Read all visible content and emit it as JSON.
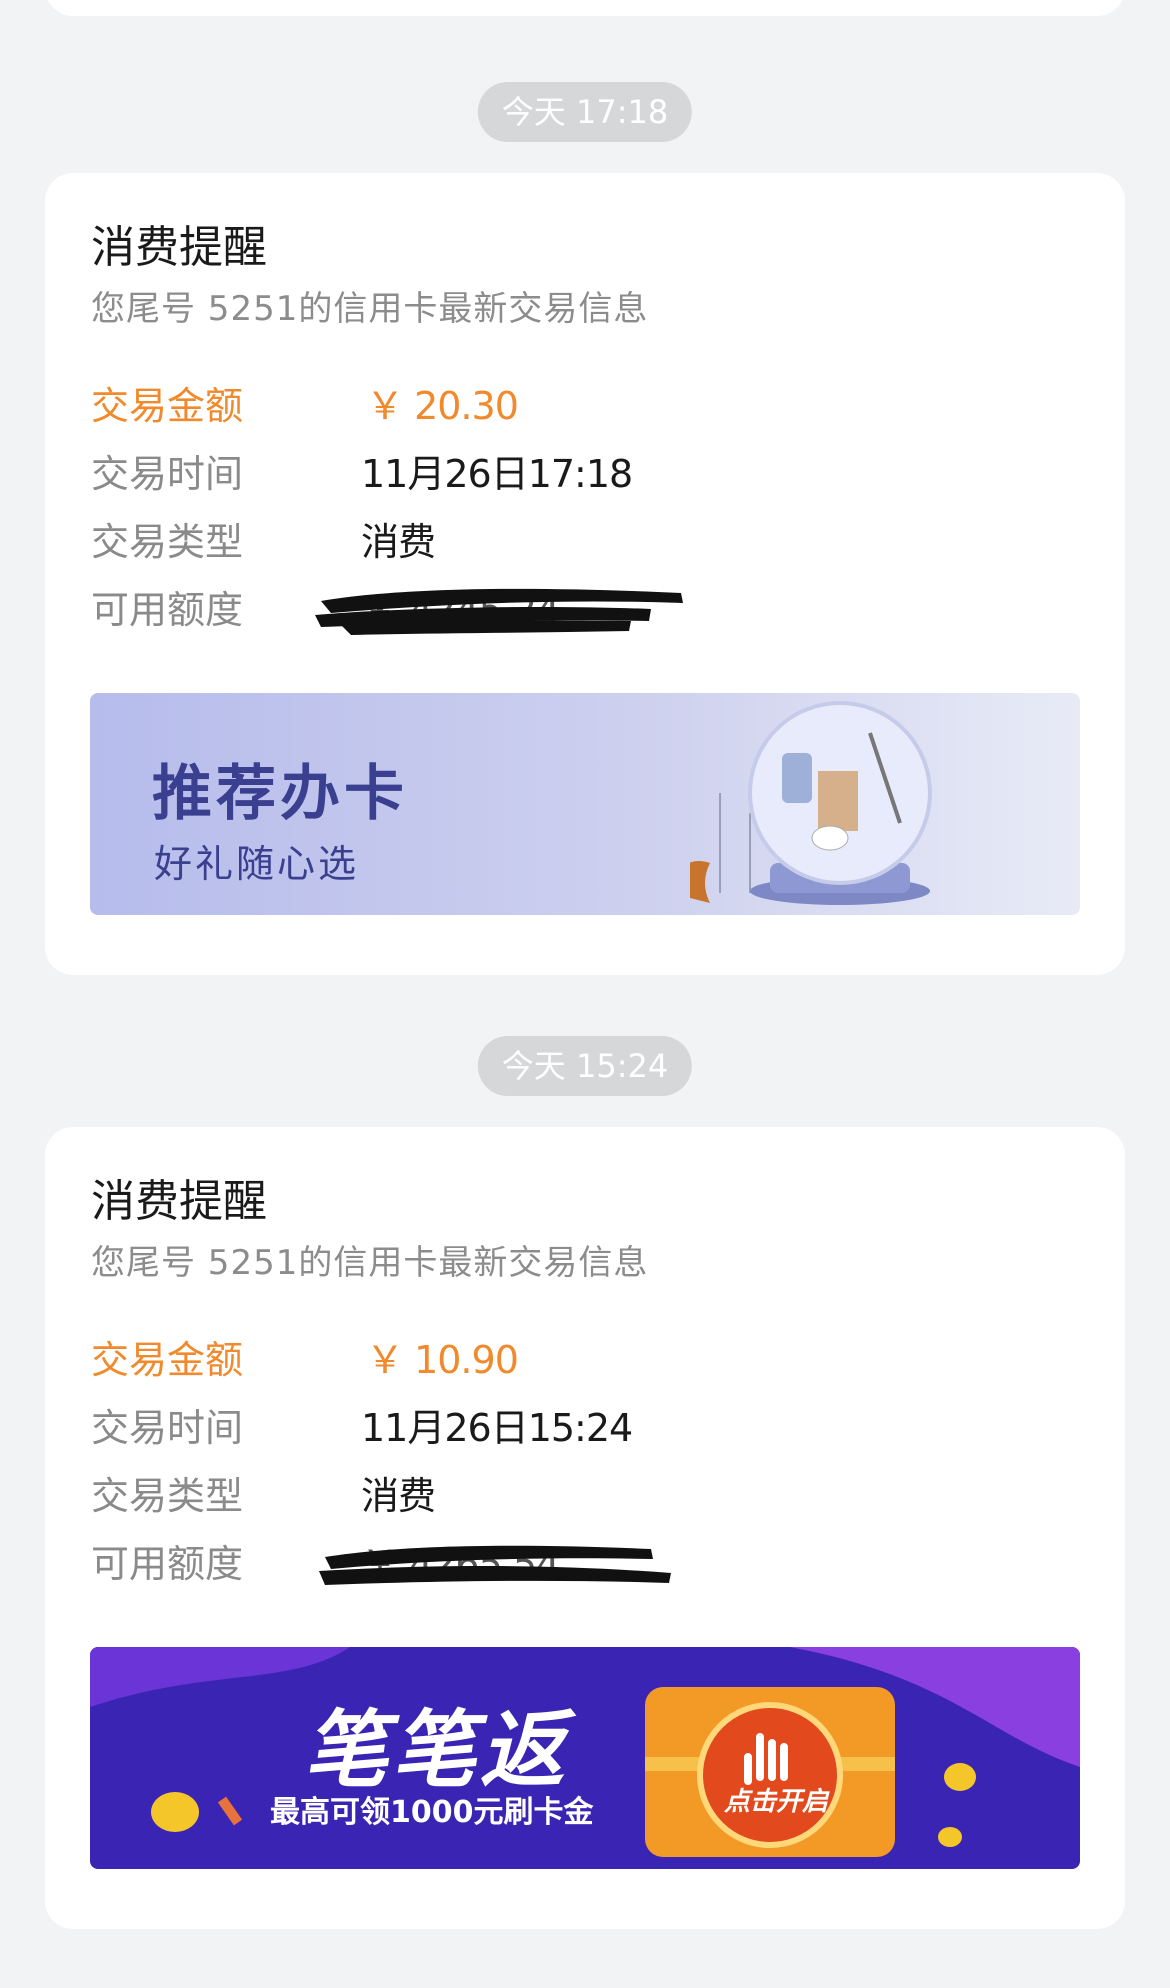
{
  "messages": [
    {
      "time": "今天 17:18",
      "title": "消费提醒",
      "subtitle": "您尾号 5251的信用卡最新交易信息",
      "rows": [
        {
          "label": "交易金额",
          "value": "￥ 20.30"
        },
        {
          "label": "交易时间",
          "value": "11月26日17:18"
        },
        {
          "label": "交易类型",
          "value": "消费"
        },
        {
          "label": "可用额度",
          "value": "￥ 4245.24"
        }
      ],
      "banner": {
        "title": "推荐办卡",
        "subtitle": "好礼随心选"
      }
    },
    {
      "time": "今天 15:24",
      "title": "消费提醒",
      "subtitle": "您尾号 5251的信用卡最新交易信息",
      "rows": [
        {
          "label": "交易金额",
          "value": "￥ 10.90"
        },
        {
          "label": "交易时间",
          "value": "11月26日15:24"
        },
        {
          "label": "交易类型",
          "value": "消费"
        },
        {
          "label": "可用额度",
          "value": "￥ 4265.54"
        }
      ],
      "banner": {
        "title": "笔笔返",
        "subtitle": "最高可领1000元刷卡金",
        "button": "点击开启"
      }
    }
  ],
  "colors": {
    "accent": "#f08a2c",
    "background": "#f2f3f5"
  }
}
